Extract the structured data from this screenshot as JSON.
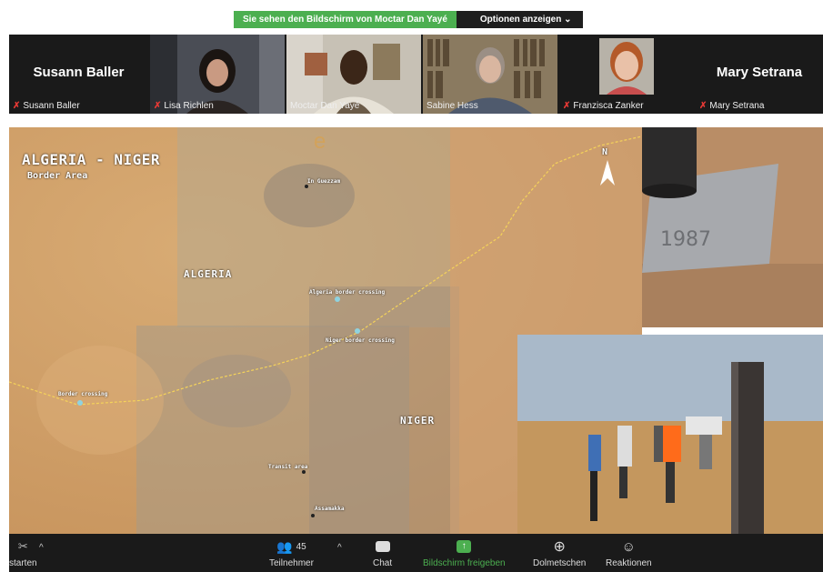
{
  "banner": {
    "sharing_text": "Sie sehen den Bildschirm von Moctar Dan Yayé",
    "options_label": "Optionen anzeigen ⌄"
  },
  "participants": [
    {
      "name": "Susann Baller",
      "label": "Susann Baller",
      "video": false
    },
    {
      "name": "Lisa Richlen",
      "label": "Lisa Richlen",
      "video": true
    },
    {
      "name": "Moctar Dan Yayé",
      "label": "Moctar Dan Yayé",
      "video": true
    },
    {
      "name": "Sabine Hess",
      "label": "Sabine Hess",
      "video": true,
      "active": true
    },
    {
      "name": "Franzisca Zanker",
      "label": "Franzisca Zanker",
      "video": true
    },
    {
      "name": "Mary Setrana",
      "label": "Mary Setrana",
      "video": false
    }
  ],
  "shared_screen": {
    "map_title": "ALGERIA - NIGER",
    "map_subtitle": "Border Area",
    "north_label": "N",
    "regions": {
      "algeria": "ALGERIA",
      "niger": "NIGER"
    },
    "places": {
      "in_guezzam": "In Guezzam",
      "algeria_crossing": "Algeria border crossing",
      "niger_crossing": "Niger border crossing",
      "border_crossing": "Border crossing",
      "transit_area": "Transit area",
      "assamakka": "Assamakka"
    }
  },
  "toolbar": {
    "start_label": "starten",
    "participants_count": "45",
    "participants_label": "Teilnehmer",
    "chat_label": "Chat",
    "share_label": "Bildschirm freigeben",
    "interpret_label": "Dolmetschen",
    "reactions_label": "Reaktionen"
  },
  "colors": {
    "share_green": "#4caf50",
    "mic_muted": "#e53935",
    "toolbar_bg": "#1a1a1a"
  }
}
